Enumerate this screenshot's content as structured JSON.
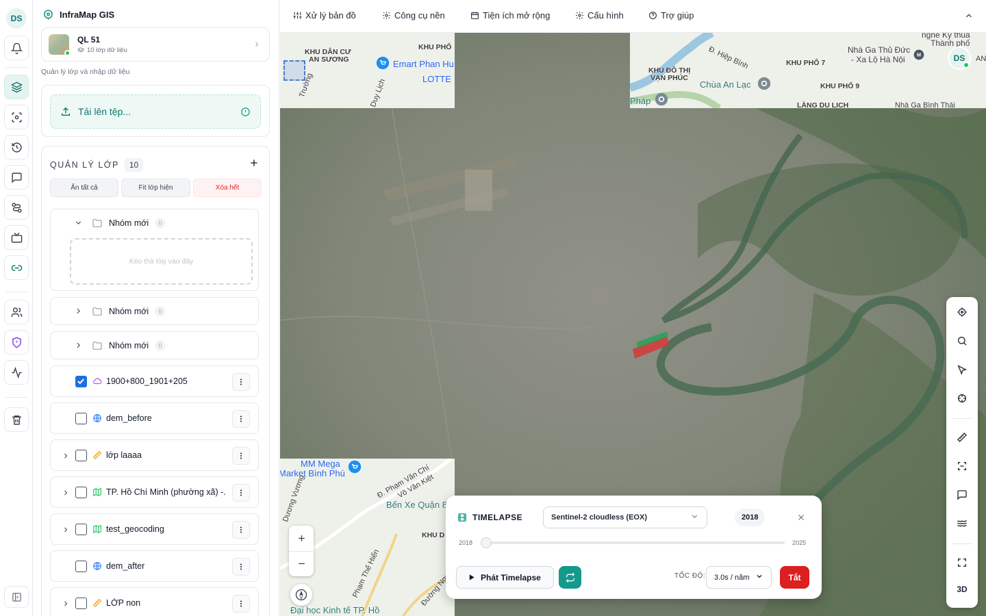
{
  "user": {
    "initials": "DS"
  },
  "app": {
    "title": "InfraMap GIS"
  },
  "project": {
    "name": "QL 51",
    "layers_info": "10 lớp dữ liệu"
  },
  "sidebar": {
    "description": "Quản lý lớp và nhập dữ liệu"
  },
  "upload": {
    "label": "Tải lên tệp..."
  },
  "layer_manager": {
    "title": "QUẢN LÝ LỚP",
    "count": "10",
    "actions": {
      "hide_all": "Ẩn tất cả",
      "fit_visible": "Fit lớp hiện",
      "delete_all": "Xóa hết"
    },
    "groups": [
      {
        "name": "Nhóm mới",
        "count": "0",
        "expanded": true,
        "drop_hint": "Kéo thả lớp vào đây"
      },
      {
        "name": "Nhóm mới",
        "count": "0",
        "expanded": false
      },
      {
        "name": "Nhóm mới",
        "count": "0",
        "expanded": false
      }
    ],
    "layers": [
      {
        "name": "1900+800_1901+205",
        "checked": true,
        "icon": "polygon-icon",
        "expandable": false
      },
      {
        "name": "dem_before",
        "checked": false,
        "icon": "globe-icon",
        "expandable": false
      },
      {
        "name": "lớp laaaa",
        "checked": false,
        "icon": "ruler-icon",
        "expandable": true
      },
      {
        "name": "TP. Hồ Chí Minh (phường xã) -...",
        "checked": false,
        "icon": "map-icon",
        "expandable": true
      },
      {
        "name": "test_geocoding",
        "checked": false,
        "icon": "map-icon",
        "expandable": true
      },
      {
        "name": "dem_after",
        "checked": false,
        "icon": "globe-icon",
        "expandable": false
      },
      {
        "name": "LỚP non",
        "checked": false,
        "icon": "ruler-icon",
        "expandable": true
      }
    ]
  },
  "topmenu": {
    "items": [
      {
        "label": "Xử lý bản đồ",
        "icon": "sliders-icon"
      },
      {
        "label": "Công cụ nền",
        "icon": "gear-icon"
      },
      {
        "label": "Tiện ích mở rộng",
        "icon": "calendar-icon"
      },
      {
        "label": "Cấu hình",
        "icon": "gear-icon"
      },
      {
        "label": "Trợ giúp",
        "icon": "help-icon"
      }
    ]
  },
  "map": {
    "labels_top_left": [
      "KHU DÂN CƯ",
      "AN SƯƠNG",
      "KHU PHỐ",
      "Emart Phan Hu",
      "LOTTE",
      "Trường",
      "Duy Lịch"
    ],
    "labels_top_right": [
      "Đ. Hiệp Bình",
      "KHU ĐÔ THỊ",
      "VẠN PHÚC",
      "Chùa An Lạc",
      "Pháp",
      "KHU PHỐ 7",
      "Nhà Ga Thủ Đức",
      "- Xa Lộ Hà Nội",
      "KHU PHỐ 9",
      "LÀNG DU LỊCH",
      "Nhà Ga Bình Thái",
      "ngne Ky thua",
      "Thành phố",
      "AN"
    ],
    "labels_bottom_left": [
      "MM Mega",
      "Market Bình Phú",
      "Đ. Phạm Văn Chí",
      "Võ Văn Kiệt",
      "Bến Xe Quận 8",
      "KHU D",
      "Dương Vương",
      "Phạm Thế Hiển",
      "Đường Nguyễn",
      "Đại học Kinh tế TP. Hồ"
    ],
    "controls": {
      "mode_3d": "3D"
    }
  },
  "timelapse": {
    "title": "TIMELAPSE",
    "source": "Sentinel-2 cloudless (EOX)",
    "current_year": "2018",
    "start_year": "2018",
    "end_year": "2025",
    "progress": 0,
    "play_label": "Phát Timelapse",
    "speed_label": "TỐC ĐỘ:",
    "speed_value": "3.0s / năm",
    "off_label": "Tắt"
  },
  "colors": {
    "accent": "#0f766e",
    "danger": "#dc1f1f",
    "check": "#1d6fe0"
  }
}
